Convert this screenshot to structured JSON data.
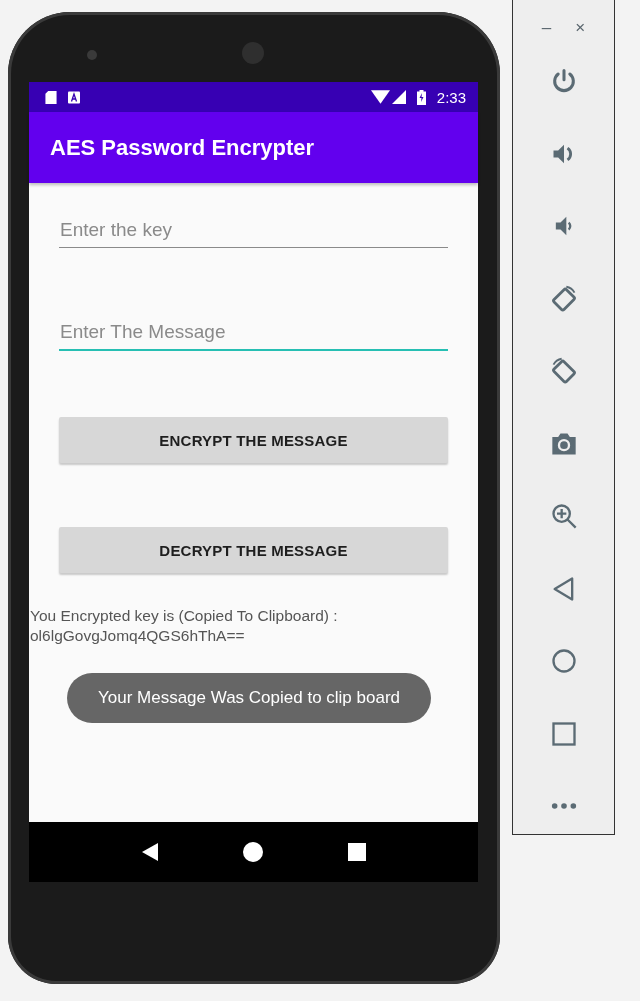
{
  "status_bar": {
    "left_icons": [
      {
        "kind": "sd-card"
      },
      {
        "kind": "notification-a"
      }
    ],
    "right_icons": [
      {
        "kind": "wifi"
      },
      {
        "kind": "signal"
      },
      {
        "kind": "battery"
      }
    ],
    "time": "2:33"
  },
  "app_bar": {
    "title": "AES Password Encrypter"
  },
  "fields": [
    {
      "placeholder": "Enter the key",
      "focused": false
    },
    {
      "placeholder": "Enter The Message",
      "focused": true
    }
  ],
  "buttons": [
    "ENCRYPT THE MESSAGE",
    "DECRYPT THE MESSAGE"
  ],
  "result": {
    "label": "You Encrypted key is (Copied To Clipboard) :",
    "value": "ol6lgGovgJomq4QGS6hThA=="
  },
  "toast": "Your Message Was Copied to clip board",
  "nav_bar": [
    {
      "kind": "back"
    },
    {
      "kind": "home"
    },
    {
      "kind": "overview"
    }
  ],
  "emulator_toolbar": {
    "window_controls": [
      "–",
      "×"
    ],
    "buttons": [
      {
        "kind": "power"
      },
      {
        "kind": "volume-up"
      },
      {
        "kind": "volume-down"
      },
      {
        "kind": "rotate-left"
      },
      {
        "kind": "rotate-right"
      },
      {
        "kind": "camera"
      },
      {
        "kind": "zoom"
      },
      {
        "kind": "back"
      },
      {
        "kind": "home"
      },
      {
        "kind": "overview"
      },
      {
        "kind": "more"
      }
    ]
  }
}
